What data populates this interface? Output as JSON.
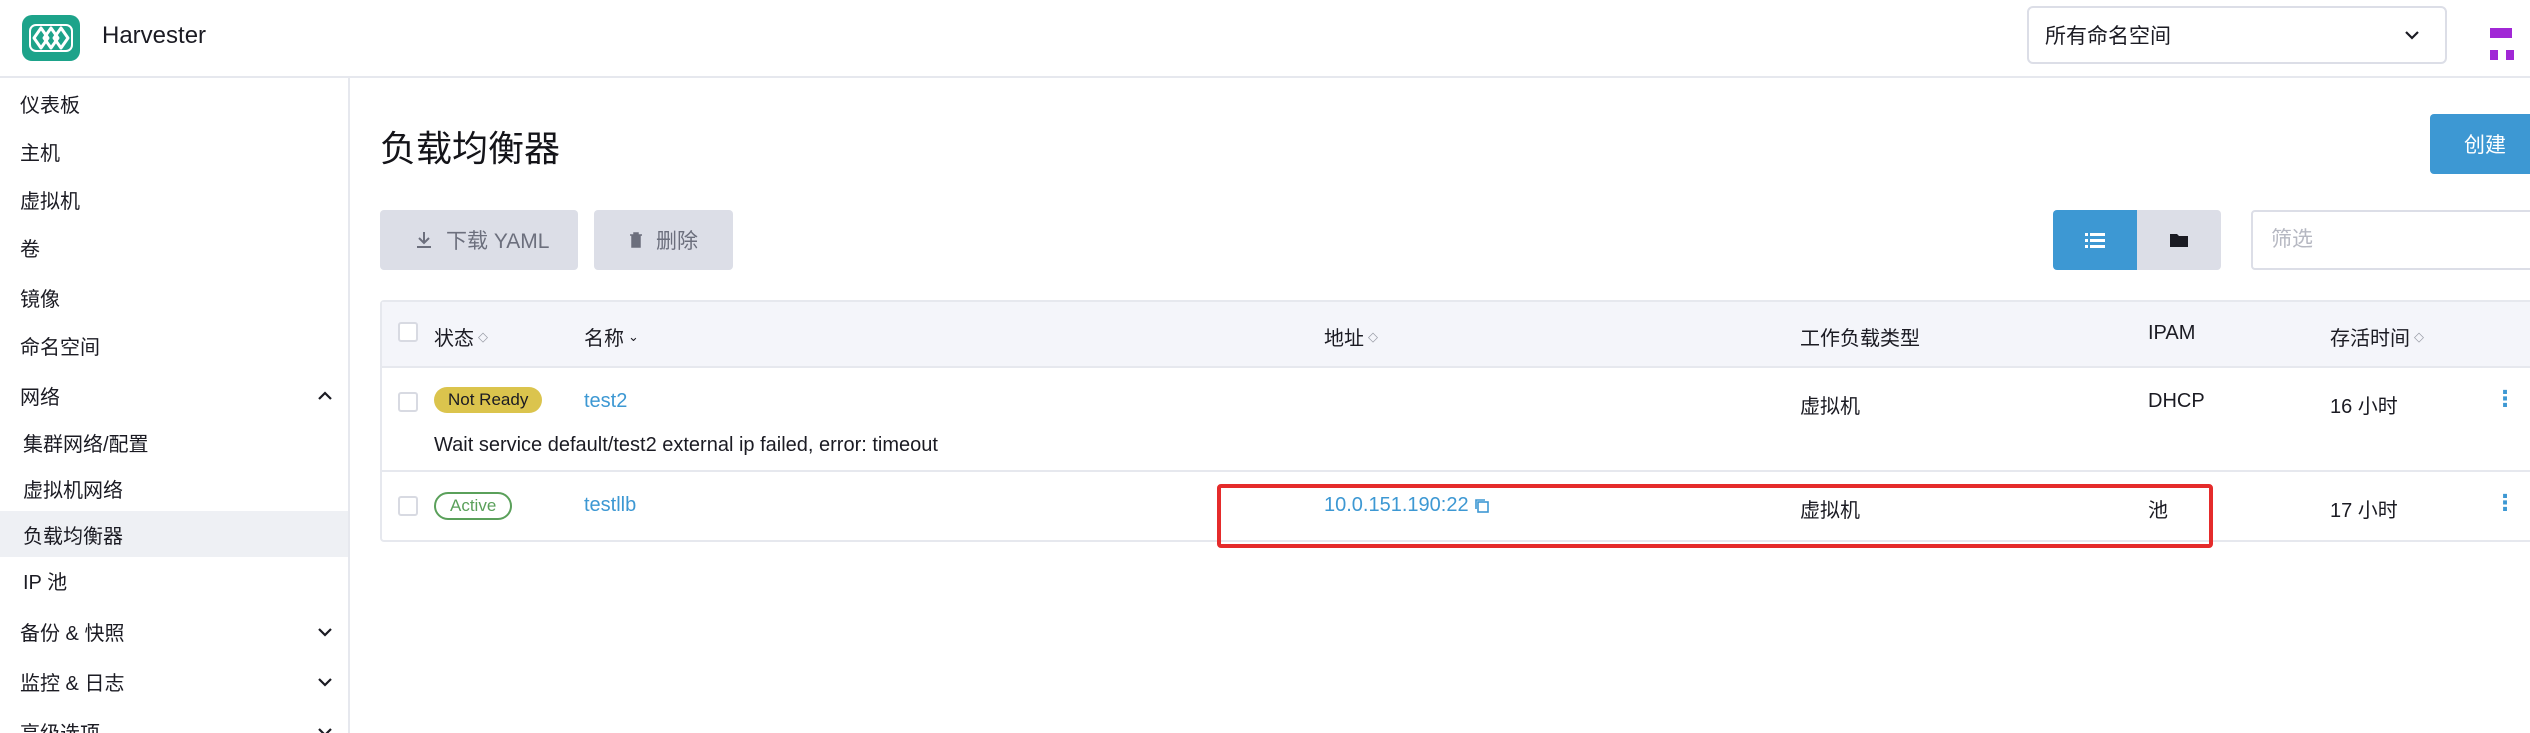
{
  "app": {
    "title": "Harvester",
    "logo_icon": "harvester-logo-icon"
  },
  "header": {
    "namespace_select": "所有命名空间"
  },
  "sidebar": {
    "items": [
      {
        "label": "仪表板"
      },
      {
        "label": "主机"
      },
      {
        "label": "虚拟机"
      },
      {
        "label": "卷"
      },
      {
        "label": "镜像"
      },
      {
        "label": "命名空间"
      },
      {
        "label": "网络",
        "expanded": true
      },
      {
        "label": "集群网络/配置"
      },
      {
        "label": "虚拟机网络"
      },
      {
        "label": "负载均衡器",
        "active": true
      },
      {
        "label": "IP 池"
      },
      {
        "label": "备份 & 快照",
        "expanded": false
      },
      {
        "label": "监控 & 日志",
        "expanded": false
      },
      {
        "label": "高级选项",
        "expanded": false
      }
    ]
  },
  "main": {
    "title": "负载均衡器",
    "create_label": "创建",
    "toolbar": {
      "download_label": "下载 YAML",
      "delete_label": "删除",
      "filter_placeholder": "筛选"
    },
    "table": {
      "headers": {
        "state": "状态",
        "name": "名称",
        "address": "地址",
        "workload_type": "工作负载类型",
        "ipam": "IPAM",
        "age": "存活时间"
      },
      "rows": [
        {
          "state": "Not Ready",
          "name": "test2",
          "address": "",
          "workload_type": "虚拟机",
          "ipam": "DHCP",
          "age": "16 小时",
          "message": "Wait service default/test2 external ip failed, error: timeout"
        },
        {
          "state": "Active",
          "name": "testllb",
          "address": "10.0.151.190:22",
          "workload_type": "虚拟机",
          "ipam": "池",
          "age": "17 小时"
        }
      ]
    }
  },
  "colors": {
    "accent": "#3d98d3",
    "brand": "#1da38a",
    "warning": "#dbc44d",
    "success": "#5aa05a",
    "highlight": "#e52b2b"
  }
}
